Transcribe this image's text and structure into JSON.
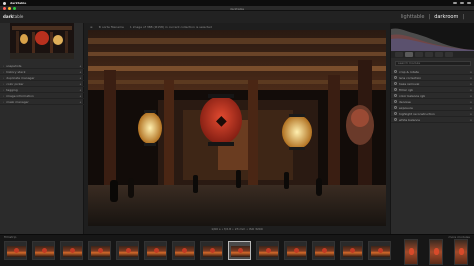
{
  "menubar": {
    "app_name": "darktable"
  },
  "window": {
    "title": "darktable"
  },
  "app": {
    "logo_prefix": "dark",
    "logo_suffix": "table"
  },
  "views": {
    "lighttable": "lighttable",
    "separator": "|",
    "darkroom": "darkroom",
    "more": "|"
  },
  "toolbar": {
    "left": "≡",
    "middle": "★  sorte  filename",
    "info": "1 image of 388 (#158) in current collection is selected"
  },
  "left_panel": {
    "modules": [
      {
        "label": "snapshots"
      },
      {
        "label": "history stack"
      },
      {
        "label": "duplicate manager"
      },
      {
        "label": "color picker"
      },
      {
        "label": "tagging"
      },
      {
        "label": "image information"
      },
      {
        "label": "mask manager"
      }
    ]
  },
  "image": {
    "exif_line": "1/60 s • f/2.8 • 23 mm • ISO 3200"
  },
  "right_panel": {
    "search_placeholder": "search module",
    "modules": [
      {
        "label": "crop & rotate"
      },
      {
        "label": "lens correction"
      },
      {
        "label": "haze removal"
      },
      {
        "label": "filmic rgb"
      },
      {
        "label": "color balance rgb"
      },
      {
        "label": "denoise"
      },
      {
        "label": "exposure"
      },
      {
        "label": "highlight reconstruction"
      },
      {
        "label": "white balance"
      }
    ]
  },
  "filmstrip": {
    "left_label": "filmstrip",
    "right_label": "more modules",
    "thumb_count": 14,
    "selected_index": 8
  },
  "colors": {
    "accent_close": "#ff5f57",
    "accent_min": "#febc2e",
    "accent_max": "#28c840",
    "lantern": "#c13a24"
  }
}
